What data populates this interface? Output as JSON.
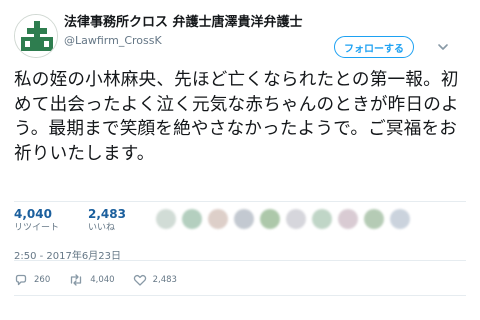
{
  "user": {
    "display_name": "法律事務所クロス 弁護士唐澤貴洋弁護士",
    "handle": "@Lawfirm_CrossK"
  },
  "follow_label": "フォローする",
  "tweet_text": "私の姪の小林麻央、先ほど亡くなられたとの第一報。初めて出会ったよく泣く元気な赤ちゃんのときが昨日のよう。最期まで笑顔を絶やさなかったようで。ご冥福をお祈りいたします。",
  "stats": {
    "retweets": {
      "count": "4,040",
      "label": "リツイート"
    },
    "likes": {
      "count": "2,483",
      "label": "いいね"
    }
  },
  "timestamp": "2:50 - 2017年6月23日",
  "actions": {
    "reply_count": "260",
    "retweet_count": "4,040",
    "like_count": "2,483"
  },
  "icons": {
    "avatar": "law-firm-logo-icon",
    "chevron": "chevron-down-icon",
    "reply": "reply-icon",
    "retweet": "retweet-icon",
    "like": "heart-icon"
  },
  "colors": {
    "accent": "#1da1f2",
    "stat_number": "#1b5f9d",
    "muted": "#657786",
    "text": "#14171a",
    "logo_green": "#2e7d4f"
  }
}
